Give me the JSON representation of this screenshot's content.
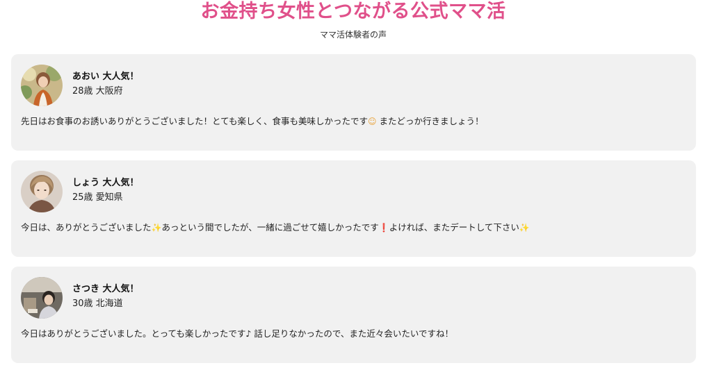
{
  "header": {
    "title": "お金持ち女性とつながる公式ママ活",
    "subtitle": "ママ活体験者の声"
  },
  "reviews": [
    {
      "name": "あおい 大人気！",
      "meta": "28歳 大阪府",
      "text_1": "先日はお食事のお誘いありがとうございました！とても楽しく、食事も美味しかったです",
      "emoji_1": "☺",
      "text_2": " またどっか行きましょう！"
    },
    {
      "name": "しょう 大人気！",
      "meta": "25歳 愛知県",
      "text_1": "今日は、ありがとうございました",
      "emoji_1": "✨",
      "text_2": "あっという間でしたが、一緒に過ごせて嬉しかったです",
      "emoji_2": "❗",
      "text_3": "よければ、またデートして下さい",
      "emoji_3": "✨"
    },
    {
      "name": "さつき 大人気！",
      "meta": "30歳 北海道",
      "text_1": "今日はありがとうございました。とっても楽しかったです♪ 話し足りなかったので、また近々会いたいですね！"
    }
  ],
  "colors": {
    "title": "#e0508a",
    "card_bg": "#f1f1f1"
  }
}
